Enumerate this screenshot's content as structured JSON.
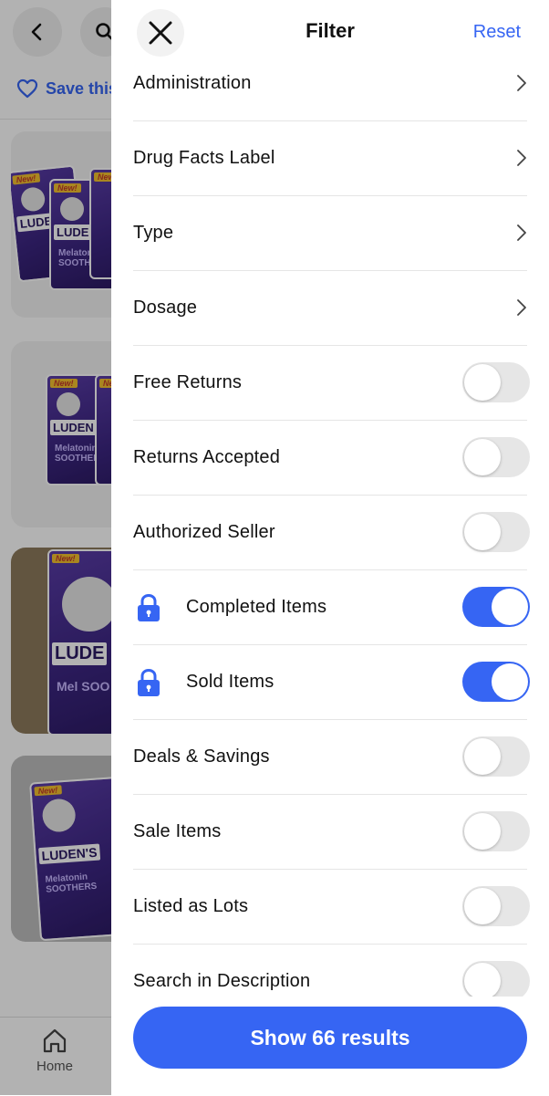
{
  "background": {
    "save_search_label": "Save this",
    "tab_home_label": "Home",
    "products": [
      {
        "brand": "LUDEN",
        "sub": "Melatonin SOOTHERS",
        "badge": "New!"
      },
      {
        "brand": "LUDEN",
        "sub": "Melatonin SOOTHERS",
        "badge": "New!"
      },
      {
        "brand": "LUDE",
        "sub": "Mel SOO",
        "badge": "New!"
      },
      {
        "brand": "LUDEN'S",
        "sub": "Melatonin SOOTHERS",
        "badge": "New!"
      }
    ]
  },
  "filter": {
    "title": "Filter",
    "reset_label": "Reset",
    "nav_rows": [
      {
        "label": "Administration"
      },
      {
        "label": "Drug Facts Label"
      },
      {
        "label": "Type"
      },
      {
        "label": "Dosage"
      }
    ],
    "toggle_rows": [
      {
        "label": "Free Returns",
        "on": false,
        "locked": false
      },
      {
        "label": "Returns Accepted",
        "on": false,
        "locked": false
      },
      {
        "label": "Authorized Seller",
        "on": false,
        "locked": false
      },
      {
        "label": "Completed Items",
        "on": true,
        "locked": true
      },
      {
        "label": "Sold Items",
        "on": true,
        "locked": true
      },
      {
        "label": "Deals & Savings",
        "on": false,
        "locked": false
      },
      {
        "label": "Sale Items",
        "on": false,
        "locked": false
      },
      {
        "label": "Listed as Lots",
        "on": false,
        "locked": false
      },
      {
        "label": "Search in Description",
        "on": false,
        "locked": false
      }
    ],
    "show_results_label": "Show 66 results"
  },
  "colors": {
    "accent": "#3665f3",
    "toggle_off": "#e6e6e6"
  }
}
